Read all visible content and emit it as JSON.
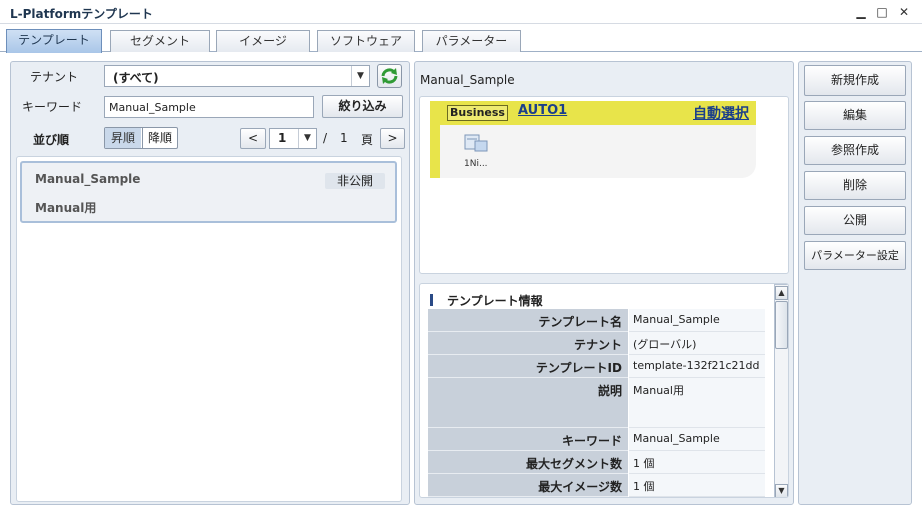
{
  "window": {
    "title": "L-Platformテンプレート",
    "minimize": "▁",
    "maximize": "□",
    "close": "✕"
  },
  "tabs": [
    {
      "label": "テンプレート",
      "active": true
    },
    {
      "label": "セグメント"
    },
    {
      "label": "イメージ"
    },
    {
      "label": "ソフトウェア"
    },
    {
      "label": "パラメーター"
    }
  ],
  "filter": {
    "tenant_label": "テナント",
    "tenant_value": "(すべて)",
    "keyword_label": "キーワード",
    "keyword_value": "Manual_Sample",
    "filter_button": "絞り込み",
    "sort_label": "並び順",
    "sort_asc": "昇順",
    "sort_desc": "降順",
    "page_current": "1",
    "page_separator": "/",
    "page_total": "1",
    "page_unit": "頁",
    "prev": "<",
    "next": ">"
  },
  "templates": [
    {
      "name": "Manual_Sample",
      "status": "非公開",
      "description": "Manual用"
    }
  ],
  "detail": {
    "name": "Manual_Sample",
    "diagram": {
      "segment_label": "Business",
      "segment_link": "AUTO1",
      "auto_select": "自動選択",
      "server_label": "1Ni..."
    },
    "info_title": "テンプレート情報",
    "info_rows": [
      {
        "key": "テンプレート名",
        "value": "Manual_Sample"
      },
      {
        "key": "テナント",
        "value": "(グローバル)"
      },
      {
        "key": "テンプレートID",
        "value": "template-132f21c21dd"
      },
      {
        "key": "説明",
        "value": "Manual用"
      },
      {
        "key": "キーワード",
        "value": "Manual_Sample"
      },
      {
        "key": "最大セグメント数",
        "value": "1 個"
      },
      {
        "key": "最大イメージ数",
        "value": "1 個"
      }
    ]
  },
  "actions": [
    "新規作成",
    "編集",
    "参照作成",
    "削除",
    "公開",
    "パラメーター設定"
  ]
}
